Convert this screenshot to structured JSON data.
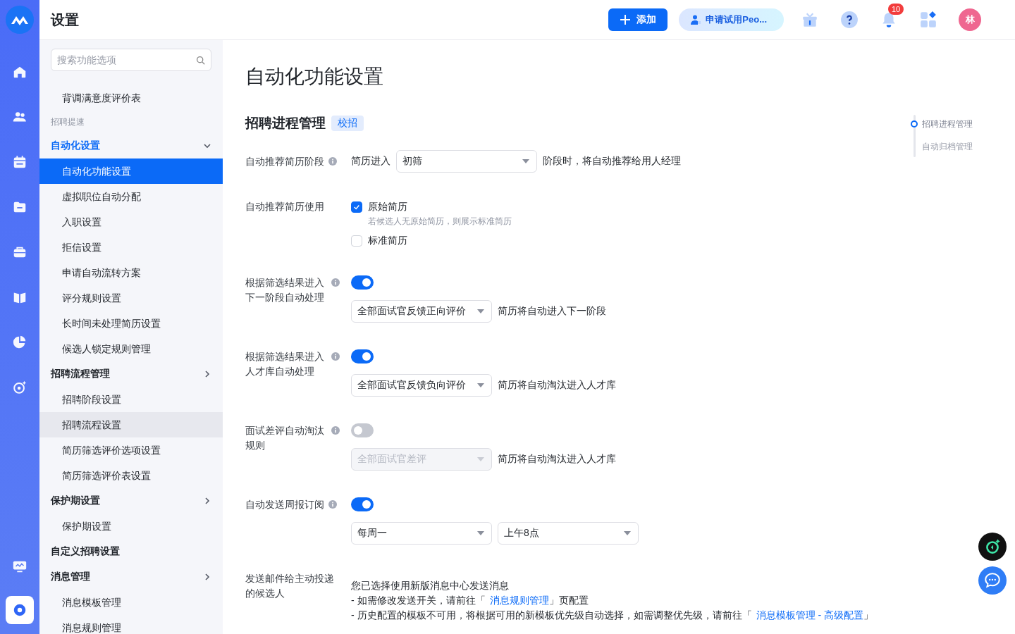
{
  "rail": {
    "items": [
      {
        "selected": false
      },
      {
        "selected": false
      },
      {
        "selected": false
      },
      {
        "selected": false
      },
      {
        "selected": false
      },
      {
        "selected": false
      },
      {
        "selected": false
      },
      {
        "selected": false
      }
    ],
    "bottom": [
      {
        "selected": false
      },
      {
        "selected": true
      }
    ]
  },
  "header": {
    "title": "设置",
    "add_button": "添加",
    "trial_button": "申请试用Peo...",
    "notification_count": "10",
    "avatar": "林"
  },
  "sidebar": {
    "search": {
      "placeholder": "搜索功能选项"
    },
    "items": [
      {
        "kind": "leaf",
        "label": "背调满意度评价表",
        "selected": false
      },
      {
        "kind": "caption",
        "label": "招聘提速"
      },
      {
        "kind": "group",
        "label": "自动化设置",
        "active": true,
        "expanded": true,
        "children": [
          {
            "label": "自动化功能设置",
            "selected": true,
            "hovered": false
          },
          {
            "label": "虚拟职位自动分配",
            "selected": false,
            "hovered": false
          },
          {
            "label": "入职设置",
            "selected": false,
            "hovered": false
          },
          {
            "label": "拒信设置",
            "selected": false,
            "hovered": false
          },
          {
            "label": "申请自动流转方案",
            "selected": false,
            "hovered": false
          },
          {
            "label": "评分规则设置",
            "selected": false,
            "hovered": false
          },
          {
            "label": "长时间未处理简历设置",
            "selected": false,
            "hovered": false
          },
          {
            "label": "候选人锁定规则管理",
            "selected": false,
            "hovered": false
          }
        ]
      },
      {
        "kind": "group",
        "label": "招聘流程管理",
        "active": false,
        "expanded": false,
        "children": [
          {
            "label": "招聘阶段设置",
            "selected": false,
            "hovered": false
          },
          {
            "label": "招聘流程设置",
            "selected": false,
            "hovered": true
          },
          {
            "label": "简历筛选评价选项设置",
            "selected": false,
            "hovered": false
          },
          {
            "label": "简历筛选评价表设置",
            "selected": false,
            "hovered": false
          }
        ]
      },
      {
        "kind": "group",
        "label": "保护期设置",
        "active": false,
        "expanded": false,
        "children": [
          {
            "label": "保护期设置",
            "selected": false,
            "hovered": false
          }
        ]
      },
      {
        "kind": "group",
        "label": "自定义招聘设置",
        "active": false
      },
      {
        "kind": "group",
        "label": "消息管理",
        "active": false,
        "expanded": false,
        "children": [
          {
            "label": "消息模板管理",
            "selected": false,
            "hovered": false
          },
          {
            "label": "消息规则管理",
            "selected": false,
            "hovered": false
          }
        ]
      }
    ]
  },
  "page": {
    "title": "自动化功能设置",
    "section": {
      "title": "招聘进程管理",
      "tag": "校招",
      "rows": [
        {
          "kind": "select",
          "label": "自动推荐简历阶段",
          "info": true,
          "prefix": "简历进入",
          "selects": [
            {
              "value": "初筛",
              "disabled": false
            }
          ],
          "suffix": "阶段时，将自动推荐给用人经理"
        },
        {
          "kind": "checks",
          "label": "自动推荐简历使用",
          "options": [
            {
              "label": "原始简历",
              "checked": true,
              "hint": "若候选人无原始简历，则展示标准简历"
            },
            {
              "label": "标准简历",
              "checked": false
            }
          ]
        },
        {
          "kind": "switch",
          "label": "根据筛选结果进入下一阶段自动处理",
          "info": true,
          "on": true,
          "selects": [
            {
              "value": "全部面试官反馈正向评价",
              "disabled": false
            }
          ],
          "suffix": "简历将自动进入下一阶段"
        },
        {
          "kind": "switch",
          "label": "根据筛选结果进入人才库自动处理",
          "info": true,
          "on": true,
          "selects": [
            {
              "value": "全部面试官反馈负向评价",
              "disabled": false
            }
          ],
          "suffix": "简历将自动淘汰进入人才库"
        },
        {
          "kind": "switch",
          "label": "面试差评自动淘汰规则",
          "info": true,
          "on": false,
          "selects": [
            {
              "value": "全部面试官差评",
              "disabled": true
            }
          ],
          "suffix": "简历将自动淘汰进入人才库"
        },
        {
          "kind": "switch",
          "label": "自动发送周报订阅",
          "info": true,
          "on": true,
          "selects": [
            {
              "value": "每周一",
              "disabled": false
            },
            {
              "value": "上午8点",
              "disabled": false
            }
          ]
        },
        {
          "kind": "notice",
          "label": "发送邮件给主动投递的候选人",
          "lines": [
            [
              {
                "text": "您已选择使用新版消息中心发送消息"
              }
            ],
            [
              {
                "text": "- 如需修改发送开关，请前往「"
              },
              {
                "link": "消息规则管理"
              },
              {
                "text": "」页配置"
              }
            ],
            [
              {
                "text": "- 历史配置的模板不可用，将根据可用的新模板优先级自动选择，如需调整优先级，请前往「"
              },
              {
                "link": "消息模板管理 - 高级配置"
              },
              {
                "text": "」"
              }
            ]
          ]
        }
      ]
    }
  },
  "anchors": [
    {
      "label": "招聘进程管理",
      "selected": true
    },
    {
      "label": "自动归档管理",
      "selected": false
    }
  ]
}
